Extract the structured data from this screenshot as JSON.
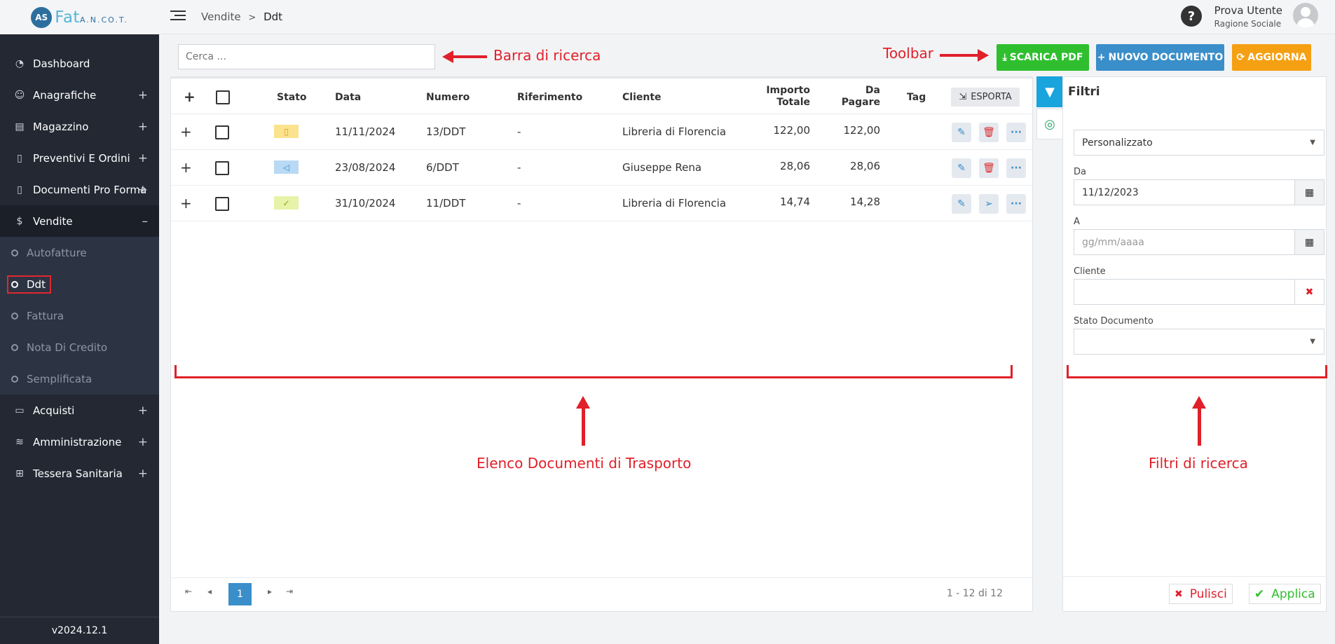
{
  "app": {
    "logo_mark": "AS",
    "logo_text": "Fat",
    "logo_sub": "A.N.CO.T.",
    "version": "v2024.12.1"
  },
  "sidebar": {
    "items": [
      {
        "label": "Dashboard",
        "icon": "dashboard-icon",
        "expand": ""
      },
      {
        "label": "Anagrafiche",
        "icon": "user-icon",
        "expand": "+"
      },
      {
        "label": "Magazzino",
        "icon": "warehouse-icon",
        "expand": "+"
      },
      {
        "label": "Preventivi E Ordini",
        "icon": "clipboard-icon",
        "expand": "+"
      },
      {
        "label": "Documenti Pro Forma",
        "icon": "document-icon",
        "expand": "+"
      },
      {
        "label": "Vendite",
        "icon": "dollar-icon",
        "expand": "–"
      }
    ],
    "sub": [
      "Autofatture",
      "Ddt",
      "Fattura",
      "Nota Di Credito",
      "Semplificata"
    ],
    "items2": [
      {
        "label": "Acquisti",
        "icon": "credit-card-icon",
        "expand": "+"
      },
      {
        "label": "Amministrazione",
        "icon": "database-icon",
        "expand": "+"
      },
      {
        "label": "Tessera Sanitaria",
        "icon": "health-card-icon",
        "expand": "+"
      }
    ]
  },
  "topbar": {
    "crumb1": "Vendite",
    "sep": ">",
    "crumb2": "Ddt",
    "help": "?",
    "user_name": "Prova Utente",
    "user_role": "Ragione Sociale"
  },
  "search": {
    "placeholder": "Cerca ..."
  },
  "toolbar": {
    "pdf": "SCARICA PDF",
    "new": "NUOVO DOCUMENTO",
    "update": "AGGIORNA"
  },
  "annotations": {
    "search": "Barra di ricerca",
    "toolbar": "Toolbar",
    "list": "Elenco Documenti di Trasporto",
    "filters": "Filtri di ricerca"
  },
  "table": {
    "headers": {
      "add": "+",
      "stato": "Stato",
      "data": "Data",
      "numero": "Numero",
      "riferimento": "Riferimento",
      "cliente": "Cliente",
      "importo1": "Importo",
      "importo2": "Totale",
      "dapagare1": "Da",
      "dapagare2": "Pagare",
      "tag": "Tag",
      "export": "ESPORTA"
    },
    "rows": [
      {
        "stato_icon": "document-status-icon",
        "stato_glyph": "🗋",
        "stato_color": "#fbe38e",
        "data": "11/11/2024",
        "numero": "13/DDT",
        "riferimento": "-",
        "cliente": "Libreria di Florencia",
        "importo": "122,00",
        "dapagare": "122,00",
        "second_action": "delete"
      },
      {
        "stato_icon": "sent-status-icon",
        "stato_glyph": "◁",
        "stato_color": "#b9d9f5",
        "data": "23/08/2024",
        "numero": "6/DDT",
        "riferimento": "-",
        "cliente": "Giuseppe Rena",
        "importo": "28,06",
        "dapagare": "28,06",
        "second_action": "delete"
      },
      {
        "stato_icon": "check-status-icon",
        "stato_glyph": "✓",
        "stato_color": "#e6f3a8",
        "data": "31/10/2024",
        "numero": "11/DDT",
        "riferimento": "-",
        "cliente": "Libreria di Florencia",
        "importo": "14,74",
        "dapagare": "14,28",
        "second_action": "send"
      }
    ],
    "pager": {
      "current": "1",
      "info": "1 - 12 di 12"
    }
  },
  "filters": {
    "title": "Filtri",
    "period": "Personalizzato",
    "da_label": "Da",
    "da_value": "11/12/2023",
    "a_label": "A",
    "a_placeholder": "gg/mm/aaaa",
    "cliente_label": "Cliente",
    "cliente_value": "",
    "stato_label": "Stato Documento",
    "stato_value": "",
    "clear": "Pulisci",
    "apply": "Applica"
  },
  "colors": {
    "sidebar": "#232833",
    "pdf": "#2fbf2e",
    "new": "#3a8ec9",
    "update": "#f5a013",
    "annotation": "#e0202a",
    "filter_tab": "#19a4dd"
  }
}
